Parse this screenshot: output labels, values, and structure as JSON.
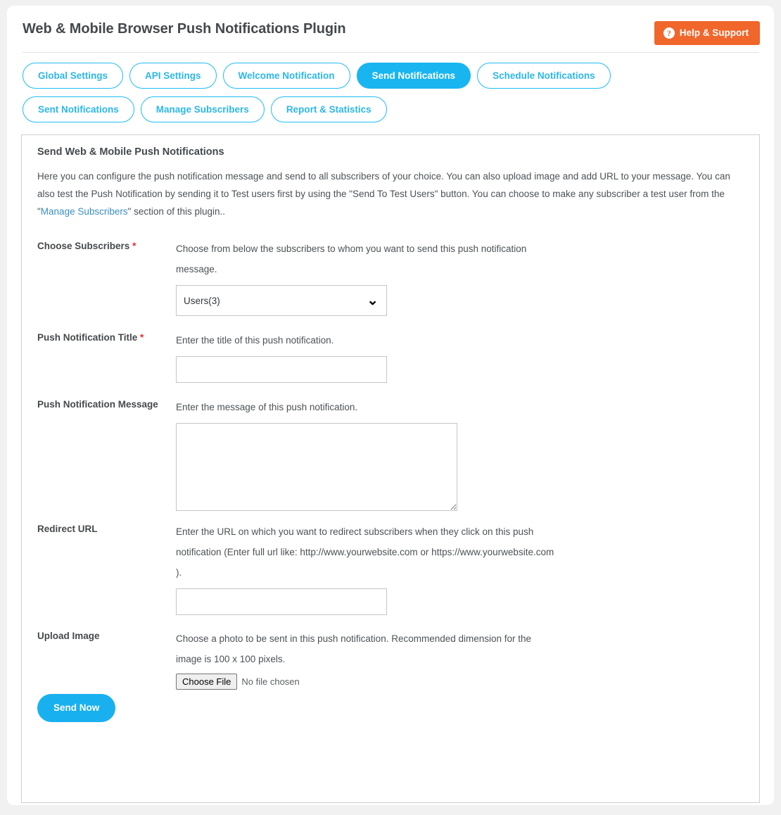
{
  "header": {
    "title": "Web & Mobile Browser Push Notifications Plugin",
    "help_button": "Help & Support",
    "help_icon": "question-circle-icon"
  },
  "tabs": [
    {
      "label": "Global Settings",
      "active": false
    },
    {
      "label": "API Settings",
      "active": false
    },
    {
      "label": "Welcome Notification",
      "active": false
    },
    {
      "label": "Send Notifications",
      "active": true
    },
    {
      "label": "Schedule Notifications",
      "active": false
    },
    {
      "label": "Sent Notifications",
      "active": false
    },
    {
      "label": "Manage Subscribers",
      "active": false
    },
    {
      "label": "Report & Statistics",
      "active": false
    }
  ],
  "panel": {
    "title": "Send Web & Mobile Push Notifications",
    "description_part1": "Here you can configure the push notification message and send to all subscribers of your choice. You can also upload image and add URL to your message. You can also test the Push Notification by sending it to Test users first by using the \"Send To Test Users\" button. You can choose to make any subscriber a test user from the \"",
    "description_link": "Manage Subscribers",
    "description_part2": "\" section of this plugin.."
  },
  "fields": {
    "subscribers": {
      "label": "Choose Subscribers",
      "required": "*",
      "description": "Choose from below the subscribers to whom you want to send this push notification message.",
      "selected_option": "Users(3)",
      "options": [
        "Users(3)"
      ],
      "chevron_icon": "chevron-down-icon"
    },
    "title": {
      "label": "Push Notification Title",
      "required": "*",
      "description": "Enter the title of this push notification.",
      "value": "",
      "placeholder": ""
    },
    "message": {
      "label": "Push Notification Message",
      "description": "Enter the message of this push notification.",
      "value": "",
      "placeholder": ""
    },
    "redirect_url": {
      "label": "Redirect URL",
      "description": "Enter the URL on which you want to redirect subscribers when they click on this push notification (Enter full url like: http://www.yourwebsite.com or https://www.yourwebsite.com ).",
      "value": "",
      "placeholder": ""
    },
    "upload_image": {
      "label": "Upload Image",
      "description": "Choose a photo to be sent in this push notification. Recommended dimension for the image is 100 x 100 pixels.",
      "choose_file_label": "Choose File",
      "no_file_text": "No file chosen"
    }
  },
  "actions": {
    "send_now": "Send Now"
  },
  "colors": {
    "accent_cyan": "#19b5f1",
    "tab_border": "#1fbdf5",
    "help_orange": "#f0662b",
    "required_red": "#e8262e",
    "link_blue": "#3b8fc4",
    "page_bg": "#f1f1f1"
  }
}
